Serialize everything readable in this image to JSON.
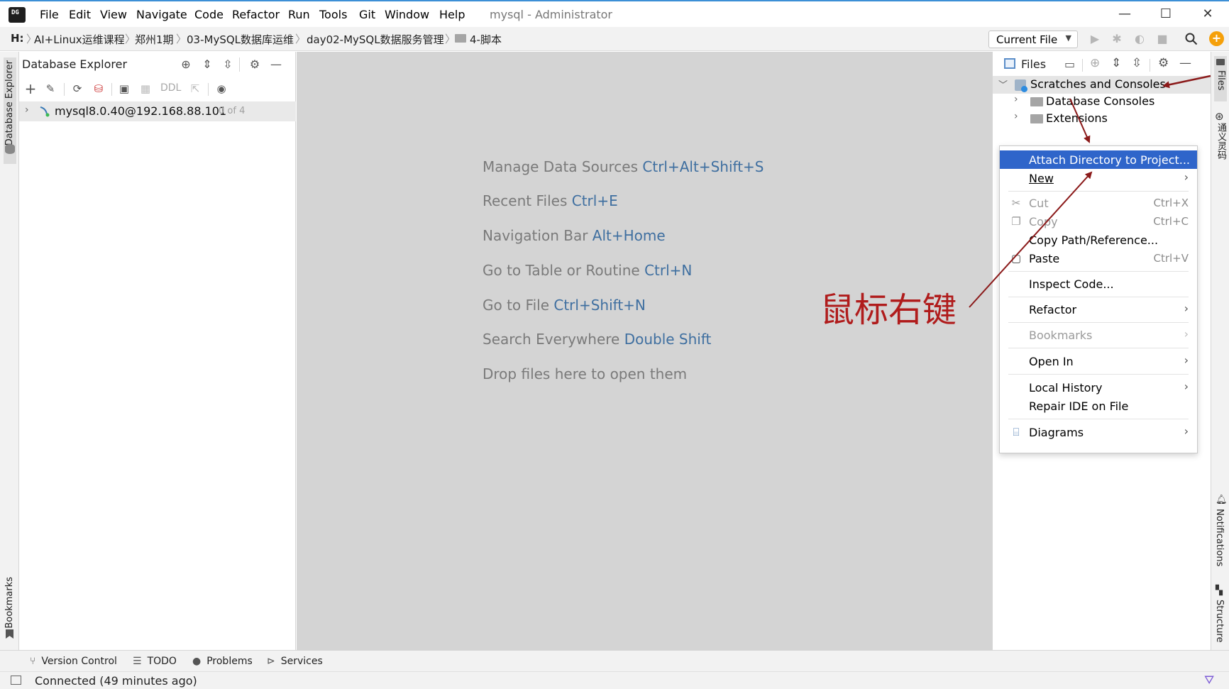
{
  "titlebar": {
    "app_icon": "ide-logo-icon",
    "menu": [
      "File",
      "Edit",
      "View",
      "Navigate",
      "Code",
      "Refactor",
      "Run",
      "Tools",
      "Git",
      "Window",
      "Help"
    ],
    "window_title": "mysql - Administrator",
    "controls": {
      "minimize": "—",
      "maximize": "☐",
      "close": "✕"
    }
  },
  "navbar": {
    "drive": "H:",
    "crumbs": [
      "AI+Linux运维课程",
      "郑州1期",
      "03-MySQL数据库运维",
      "day02-MySQL数据服务管理",
      "4-脚本"
    ],
    "run_config": "Current File"
  },
  "left_stripe": {
    "top_label": "Database Explorer",
    "bottom_label": "Bookmarks"
  },
  "db_explorer": {
    "title": "Database Explorer",
    "toolbar_ddl": "DDL",
    "datasource": {
      "name": "mysql8.0.40@192.168.88.101",
      "count": "0 of 4"
    }
  },
  "editor": {
    "hints": [
      {
        "text": "Manage Data Sources",
        "shortcut": "Ctrl+Alt+Shift+S"
      },
      {
        "text": "Recent Files",
        "shortcut": "Ctrl+E"
      },
      {
        "text": "Navigation Bar",
        "shortcut": "Alt+Home"
      },
      {
        "text": "Go to Table or Routine",
        "shortcut": "Ctrl+N"
      },
      {
        "text": "Go to File",
        "shortcut": "Ctrl+Shift+N"
      },
      {
        "text": "Search Everywhere",
        "shortcut": "Double Shift"
      },
      {
        "text": "Drop files here to open them",
        "shortcut": ""
      }
    ],
    "annotation": "鼠标右键",
    "annotation_color": "#b01c1c"
  },
  "files_panel": {
    "title": "Files",
    "tree": [
      {
        "label": "Scratches and Consoles",
        "expanded": true
      },
      {
        "label": "Database Consoles"
      },
      {
        "label": "Extensions"
      }
    ]
  },
  "right_stripe": {
    "files": "Files",
    "tongyi": "通义灵码",
    "notifications": "Notifications",
    "structure": "Structure"
  },
  "context_menu": {
    "items": [
      {
        "label": "Attach Directory to Project...",
        "selected": true
      },
      {
        "label": "New",
        "submenu": true
      },
      {
        "label": "Cut",
        "shortcut": "Ctrl+X",
        "disabled": true,
        "icon": "scissors-icon"
      },
      {
        "label": "Copy",
        "shortcut": "Ctrl+C",
        "disabled": true,
        "icon": "copy-icon"
      },
      {
        "label": "Copy Path/Reference..."
      },
      {
        "label": "Paste",
        "shortcut": "Ctrl+V",
        "icon": "paste-icon"
      },
      {
        "label": "Inspect Code..."
      },
      {
        "label": "Refactor",
        "submenu": true
      },
      {
        "label": "Bookmarks",
        "submenu": true,
        "disabled": true
      },
      {
        "label": "Open In",
        "submenu": true
      },
      {
        "label": "Local History",
        "submenu": true
      },
      {
        "label": "Repair IDE on File"
      },
      {
        "label": "Diagrams",
        "submenu": true,
        "icon": "diagram-icon"
      }
    ],
    "accent": "#2f65ca"
  },
  "bottombar": {
    "tabs": [
      "Version Control",
      "TODO",
      "Problems",
      "Services"
    ]
  },
  "status": {
    "text": "Connected (49 minutes ago)"
  }
}
